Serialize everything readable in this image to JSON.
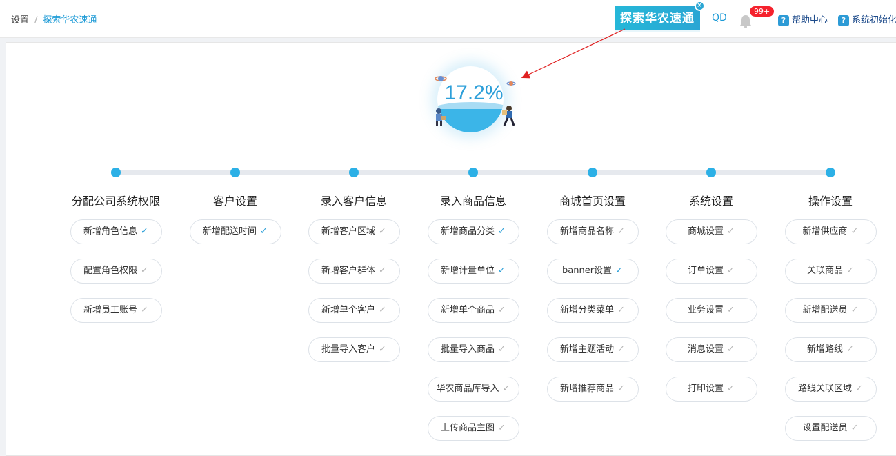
{
  "breadcrumb": {
    "root": "设置",
    "sep": "/",
    "current": "探索华农速通"
  },
  "header": {
    "banner_text": "探索华农速通",
    "banner_close": "×",
    "user": "QD",
    "badge": "99+",
    "help_q": "?",
    "help_center": "帮助中心",
    "system_init": "系统初始化"
  },
  "progress": {
    "value": "17.2%",
    "fraction": 0.172
  },
  "colors": {
    "accent": "#2cb0e6",
    "done": "#2b9fd8",
    "pending": "#b5b5b5",
    "badge": "#f5222d"
  },
  "check_mark": "✓",
  "steps": [
    {
      "title": "分配公司系统权限",
      "items": [
        {
          "label": "新增角色信息",
          "done": true
        },
        {
          "label": "配置角色权限",
          "done": false
        },
        {
          "label": "新增员工账号",
          "done": false
        }
      ]
    },
    {
      "title": "客户设置",
      "items": [
        {
          "label": "新增配送时间",
          "done": true
        }
      ]
    },
    {
      "title": "录入客户信息",
      "items": [
        {
          "label": "新增客户区域",
          "done": false
        },
        {
          "label": "新增客户群体",
          "done": false
        },
        {
          "label": "新增单个客户",
          "done": false
        },
        {
          "label": "批量导入客户",
          "done": false
        }
      ]
    },
    {
      "title": "录入商品信息",
      "items": [
        {
          "label": "新增商品分类",
          "done": true
        },
        {
          "label": "新增计量单位",
          "done": true
        },
        {
          "label": "新增单个商品",
          "done": false
        },
        {
          "label": "批量导入商品",
          "done": false
        },
        {
          "label": "华农商品库导入",
          "done": false
        },
        {
          "label": "上传商品主图",
          "done": false
        }
      ]
    },
    {
      "title": "商城首页设置",
      "items": [
        {
          "label": "新增商品名称",
          "done": false
        },
        {
          "label": "banner设置",
          "done": true
        },
        {
          "label": "新增分类菜单",
          "done": false
        },
        {
          "label": "新增主题活动",
          "done": false
        },
        {
          "label": "新增推荐商品",
          "done": false
        }
      ]
    },
    {
      "title": "系统设置",
      "items": [
        {
          "label": "商城设置",
          "done": false
        },
        {
          "label": "订单设置",
          "done": false
        },
        {
          "label": "业务设置",
          "done": false
        },
        {
          "label": "消息设置",
          "done": false
        },
        {
          "label": "打印设置",
          "done": false
        }
      ]
    },
    {
      "title": "操作设置",
      "items": [
        {
          "label": "新增供应商",
          "done": false
        },
        {
          "label": "关联商品",
          "done": false
        },
        {
          "label": "新增配送员",
          "done": false
        },
        {
          "label": "新增路线",
          "done": false
        },
        {
          "label": "路线关联区域",
          "done": false
        },
        {
          "label": "设置配送员",
          "done": false
        }
      ]
    }
  ]
}
